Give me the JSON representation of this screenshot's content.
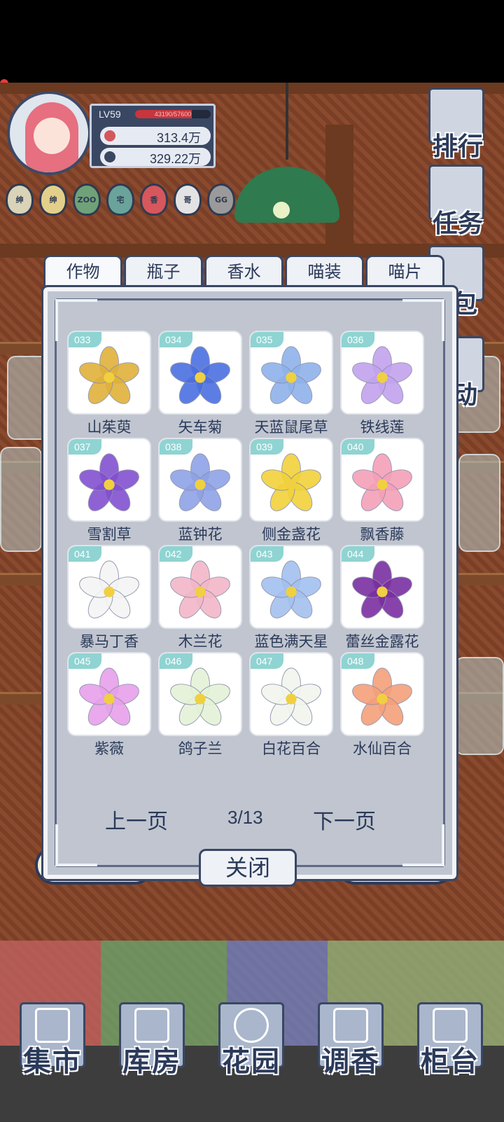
{
  "profile": {
    "level": "LV59",
    "xp": "43190/57600",
    "xp_fraction": 0.75,
    "coins": "313.4万",
    "gems": "329.22万"
  },
  "badges": [
    "绅",
    "绅",
    "ZOO",
    "宅",
    "香",
    "哥",
    "GG"
  ],
  "side_menu": {
    "rank": "排行",
    "task": "任务",
    "bag": "包",
    "event": "动"
  },
  "tabs": [
    "作物",
    "瓶子",
    "香水",
    "喵装",
    "喵片"
  ],
  "active_tab": 0,
  "cards": [
    {
      "num": "033",
      "name": "山茱萸",
      "color": "#e0b13a"
    },
    {
      "num": "034",
      "name": "矢车菊",
      "color": "#4b6fe0"
    },
    {
      "num": "035",
      "name": "天蓝鼠尾草",
      "color": "#8fb2ea"
    },
    {
      "num": "036",
      "name": "铁线莲",
      "color": "#c3a3ee"
    },
    {
      "num": "037",
      "name": "雪割草",
      "color": "#8250d0"
    },
    {
      "num": "038",
      "name": "蓝钟花",
      "color": "#8fa2e6"
    },
    {
      "num": "039",
      "name": "侧金盏花",
      "color": "#f2d23a"
    },
    {
      "num": "040",
      "name": "飘香藤",
      "color": "#f4a0b8"
    },
    {
      "num": "041",
      "name": "暴马丁香",
      "color": "#f4f4f4"
    },
    {
      "num": "042",
      "name": "木兰花",
      "color": "#f3b6c8"
    },
    {
      "num": "043",
      "name": "蓝色满天星",
      "color": "#a3c0ef"
    },
    {
      "num": "044",
      "name": "蕾丝金露花",
      "color": "#7a2fa0"
    },
    {
      "num": "045",
      "name": "紫薇",
      "color": "#e7a0ea"
    },
    {
      "num": "046",
      "name": "鸽子兰",
      "color": "#e4f2d6"
    },
    {
      "num": "047",
      "name": "白花百合",
      "color": "#f2f6ee"
    },
    {
      "num": "048",
      "name": "水仙百合",
      "color": "#f4a07a"
    }
  ],
  "pager": {
    "prev": "上一页",
    "page": "3/13",
    "next": "下一页"
  },
  "close": "关闭",
  "bottom_nav": [
    "集市",
    "库房",
    "花园",
    "调香",
    "柜台"
  ]
}
